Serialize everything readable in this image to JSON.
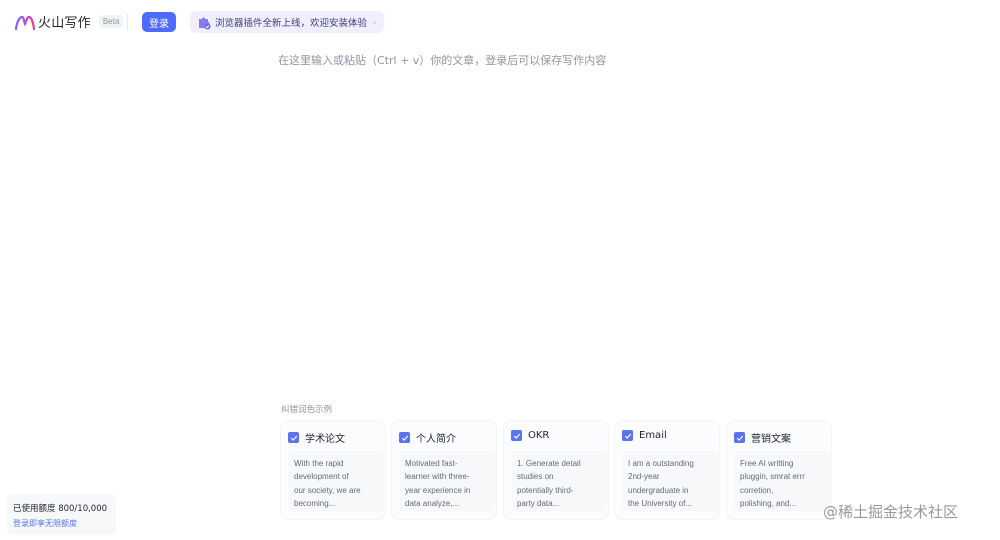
{
  "header": {
    "app_name": "火山写作",
    "beta_badge": "Beta",
    "login_label": "登录",
    "banner_text": "浏览器插件全新上线，欢迎安装体验",
    "banner_arrow": "›"
  },
  "editor": {
    "placeholder": "在这里输入或粘贴（Ctrl + v）你的文章，登录后可以保存写作内容"
  },
  "examples": {
    "title": "纠错润色示例",
    "cards": [
      {
        "title": "学术论文",
        "lines": [
          "With the rapid",
          "development of",
          "our society, we are",
          "becoming..."
        ]
      },
      {
        "title": "个人简介",
        "lines": [
          "Motivated fast-",
          "learner with three-",
          "year experience in",
          "data analyze,..."
        ]
      },
      {
        "title": "OKR",
        "lines": [
          "1. Generate detail",
          "studies on",
          "potentially third-",
          "party data..."
        ]
      },
      {
        "title": "Email",
        "lines": [
          "I am a outstanding",
          "2nd-year",
          "undergraduate in",
          "the University of..."
        ]
      },
      {
        "title": "营销文案",
        "lines": [
          "Free AI writting",
          "pluggin, smrat errr",
          "corretion,",
          "polishing, and..."
        ]
      }
    ]
  },
  "usage": {
    "label": "已使用额度 800/10,000",
    "link": "登录即享无限额度"
  },
  "watermark": "@稀土掘金技术社区",
  "colors": {
    "accent": "#4d6bfe",
    "banner_bg": "#f1efff",
    "placeholder": "#8f959e"
  }
}
